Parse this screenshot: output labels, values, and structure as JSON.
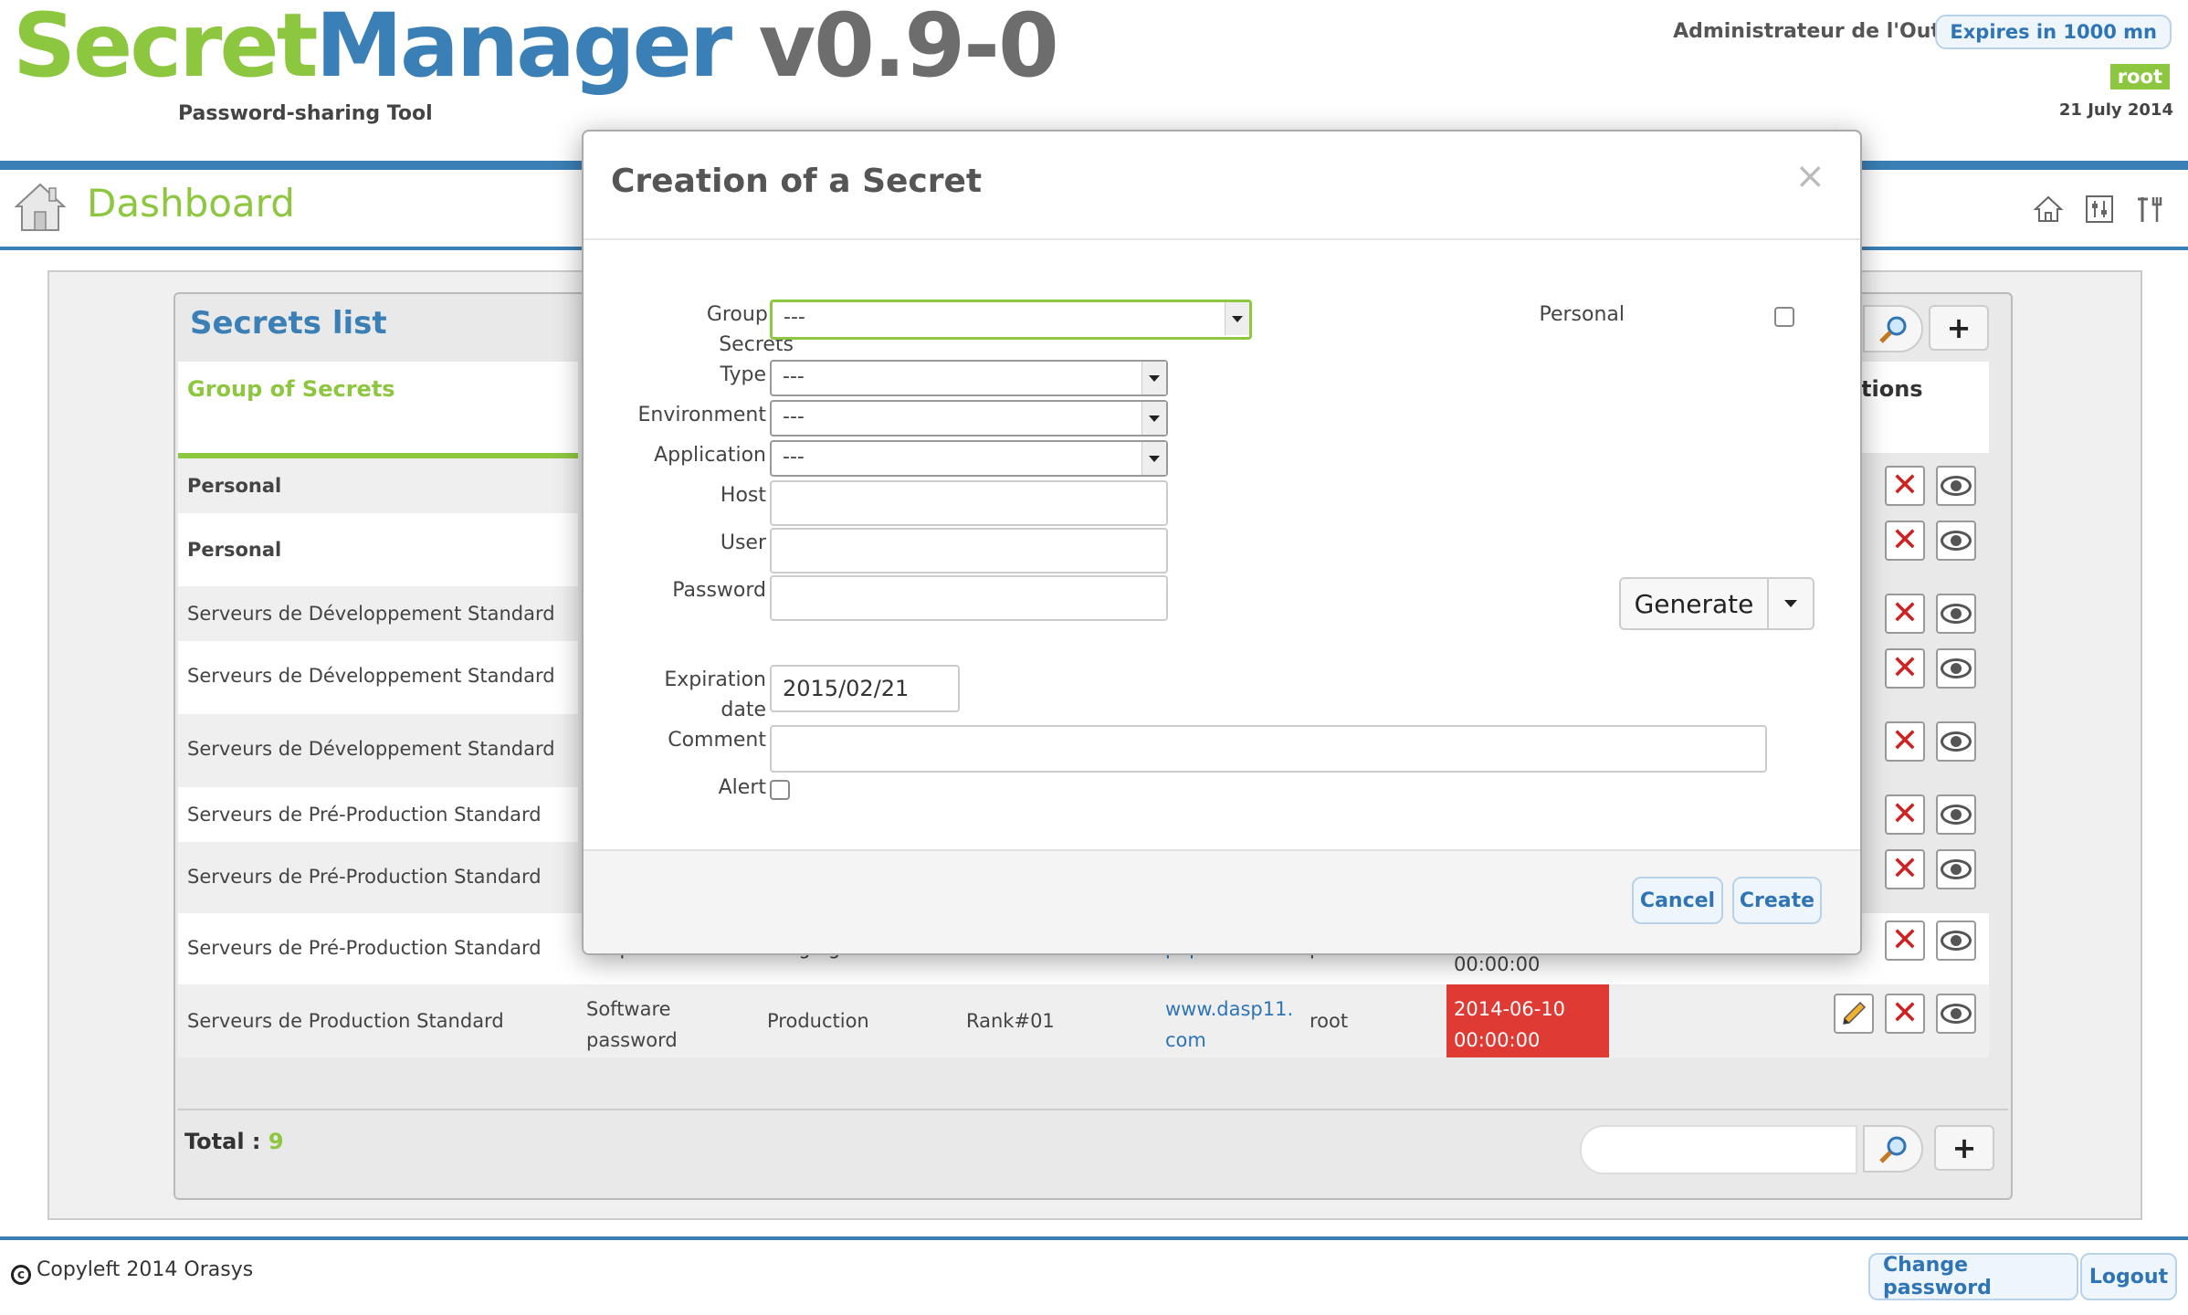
{
  "header": {
    "logo_part1": "Secret",
    "logo_part2": "Manager",
    "logo_version": " v0.9-0",
    "subtitle": "Password-sharing Tool",
    "user_name": "Administrateur de l'Outil",
    "expires": "Expires in 1000 mn",
    "role_badge": "root",
    "date": "21 July 2014"
  },
  "page": {
    "title": "Dashboard"
  },
  "secrets_list": {
    "title": "Secrets list",
    "col_group": "Group of Secrets",
    "col_operations_partial": "tions",
    "rows": [
      {
        "group": "Personal"
      },
      {
        "group": "Personal"
      },
      {
        "group": "Serveurs de Développement Standard"
      },
      {
        "group": "Serveurs de Développement Standard"
      },
      {
        "group": "Serveurs de Développement Standard"
      },
      {
        "group": "Serveurs de Pré-Production Standard"
      },
      {
        "group": "Serveurs de Pré-Production Standard"
      },
      {
        "group": "Serveurs de Pré-Production Standard"
      },
      {
        "group": "Serveurs de Production Standard"
      }
    ],
    "partial_row8": {
      "type": "OS password",
      "env": "Staging",
      "host": "pop.",
      "user": "pls",
      "exp": "00:00:00"
    },
    "last_row": {
      "type_line1": "Software",
      "type_line2": "password",
      "environment": "Production",
      "application": "Rank#01",
      "host_line1": "www.dasp11.",
      "host_line2": "com",
      "user": "root",
      "exp_line1": "2014-06-10",
      "exp_line2": "00:00:00"
    },
    "total_label": "Total : ",
    "total_value": "9"
  },
  "footer": {
    "copyleft": "Copyleft 2014 Orasys",
    "change_password": "Change password",
    "logout": "Logout"
  },
  "modal": {
    "title": "Creation of a Secret",
    "close": "×",
    "labels": {
      "group_line1": "Group of",
      "group_line2": "Secrets",
      "type": "Type",
      "environment": "Environment",
      "application": "Application",
      "host": "Host",
      "user": "User",
      "password": "Password",
      "expiration_line1": "Expiration",
      "expiration_line2": "date",
      "comment": "Comment",
      "alert": "Alert",
      "personal": "Personal"
    },
    "values": {
      "group": "---",
      "type": "---",
      "environment": "---",
      "application": "---",
      "expiration": "2015/02/21"
    },
    "generate": "Generate",
    "cancel": "Cancel",
    "create": "Create"
  },
  "colors": {
    "green": "#8dc63f",
    "blue": "#3a7fb5",
    "red": "#e03a34"
  }
}
